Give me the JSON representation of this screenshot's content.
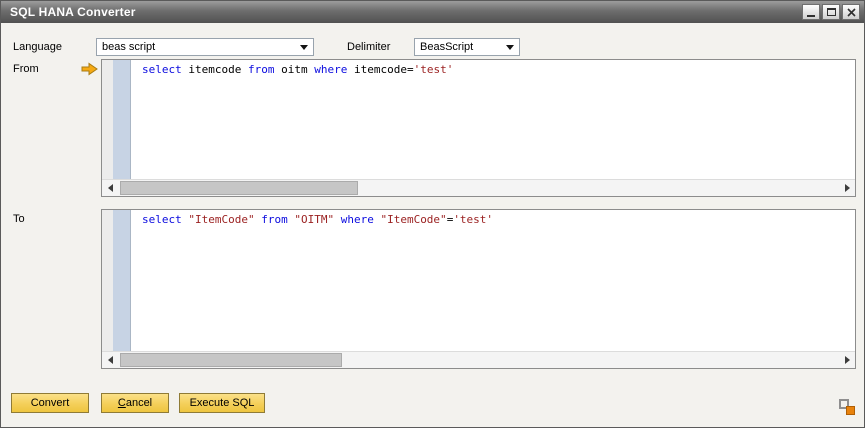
{
  "window": {
    "title": "SQL HANA Converter"
  },
  "toolbar": {
    "language_label": "Language",
    "language_value": "beas script",
    "delimiter_label": "Delimiter",
    "delimiter_value": "BeasScript"
  },
  "from_editor": {
    "label": "From",
    "tokens": [
      {
        "text": "select ",
        "color": "#0b0bdf"
      },
      {
        "text": "itemcode ",
        "color": "#000000"
      },
      {
        "text": "from ",
        "color": "#0b0bdf"
      },
      {
        "text": "oitm ",
        "color": "#000000"
      },
      {
        "text": "where ",
        "color": "#0b0bdf"
      },
      {
        "text": "itemcode",
        "color": "#000000"
      },
      {
        "text": "=",
        "color": "#000000"
      },
      {
        "text": "'test'",
        "color": "#9a1f1f"
      }
    ]
  },
  "to_editor": {
    "label": "To",
    "tokens": [
      {
        "text": "select ",
        "color": "#0b0bdf"
      },
      {
        "text": "\"ItemCode\" ",
        "color": "#9a1f1f"
      },
      {
        "text": "from ",
        "color": "#0b0bdf"
      },
      {
        "text": "\"OITM\" ",
        "color": "#9a1f1f"
      },
      {
        "text": "where ",
        "color": "#0b0bdf"
      },
      {
        "text": "\"ItemCode\"",
        "color": "#9a1f1f"
      },
      {
        "text": "=",
        "color": "#000000"
      },
      {
        "text": "'test'",
        "color": "#9a1f1f"
      }
    ]
  },
  "buttons": {
    "convert": "Convert",
    "cancel": "Cancel",
    "execute_sql": "Execute SQL"
  },
  "colors": {
    "keyword_blue": "#0b0bdf",
    "string_red": "#9a1f1f",
    "button_gold": "#f4cf5a",
    "accent_orange": "#e8820c"
  }
}
